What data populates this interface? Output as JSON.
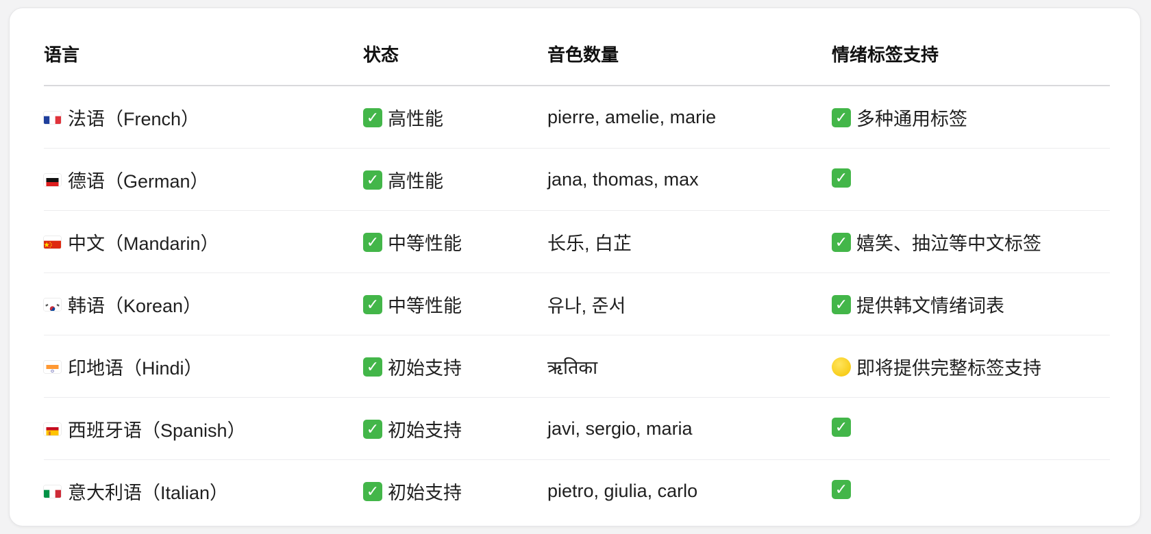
{
  "table": {
    "headers": [
      "语言",
      "状态",
      "音色数量",
      "情绪标签支持"
    ],
    "rows": [
      {
        "flag": "fr",
        "language": "法语（French）",
        "status_icon": "check-icon",
        "status": "高性能",
        "voices": "pierre, amelie, marie",
        "emotion_icon": "check-icon",
        "emotion": "多种通用标签"
      },
      {
        "flag": "de",
        "language": "德语（German）",
        "status_icon": "check-icon",
        "status": "高性能",
        "voices": "jana, thomas, max",
        "emotion_icon": "check-icon",
        "emotion": ""
      },
      {
        "flag": "cn",
        "language": "中文（Mandarin）",
        "status_icon": "check-icon",
        "status": "中等性能",
        "voices": "长乐, 白芷",
        "emotion_icon": "check-icon",
        "emotion": "嬉笑、抽泣等中文标签"
      },
      {
        "flag": "kr",
        "language": "韩语（Korean）",
        "status_icon": "check-icon",
        "status": "中等性能",
        "voices": "유나, 준서",
        "emotion_icon": "check-icon",
        "emotion": "提供韩文情绪词表"
      },
      {
        "flag": "in",
        "language": "印地语（Hindi）",
        "status_icon": "check-icon",
        "status": "初始支持",
        "voices": "ऋतिका",
        "emotion_icon": "yellow-circle-icon",
        "emotion": "即将提供完整标签支持"
      },
      {
        "flag": "es",
        "language": "西班牙语（Spanish）",
        "status_icon": "check-icon",
        "status": "初始支持",
        "voices": "javi, sergio, maria",
        "emotion_icon": "check-icon",
        "emotion": ""
      },
      {
        "flag": "it",
        "language": "意大利语（Italian）",
        "status_icon": "check-icon",
        "status": "初始支持",
        "voices": "pietro, giulia, carlo",
        "emotion_icon": "check-icon",
        "emotion": ""
      }
    ]
  },
  "colors": {
    "check_green": "#43b649",
    "circle_yellow": "#f5c400",
    "divider": "#ececee"
  }
}
